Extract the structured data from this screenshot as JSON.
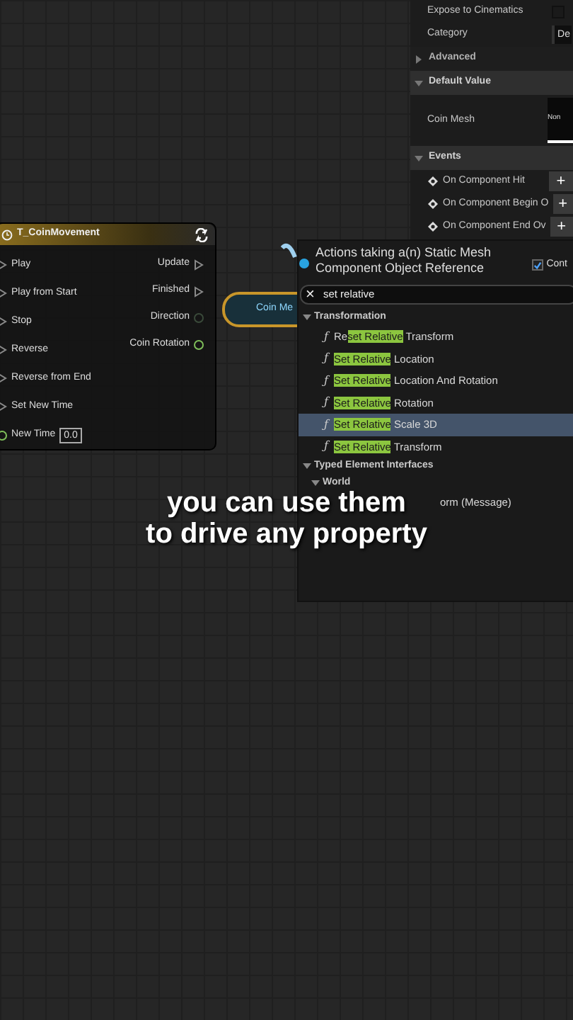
{
  "details": {
    "rows": [
      {
        "kind": "checkbox",
        "label": "Expose to Cinematics",
        "checked": false
      },
      {
        "kind": "field",
        "label": "Category",
        "value": "De"
      },
      {
        "kind": "section",
        "label": "Advanced",
        "expanded": false
      },
      {
        "kind": "section",
        "label": "Default Value",
        "expanded": true
      },
      {
        "kind": "mesh",
        "label": "Coin Mesh",
        "value": "Non"
      },
      {
        "kind": "section",
        "label": "Events",
        "expanded": true
      },
      {
        "kind": "event",
        "label": "On Component Hit",
        "button": "+"
      },
      {
        "kind": "event",
        "label": "On Component Begin O",
        "button": "+"
      },
      {
        "kind": "event",
        "label": "On Component End Ov",
        "button": "+"
      }
    ]
  },
  "timeline_node": {
    "title": "T_CoinMovement",
    "inputs": [
      {
        "label": "Play",
        "kind": "exec"
      },
      {
        "label": "Play from Start",
        "kind": "exec"
      },
      {
        "label": "Stop",
        "kind": "exec"
      },
      {
        "label": "Reverse",
        "kind": "exec"
      },
      {
        "label": "Reverse from End",
        "kind": "exec"
      },
      {
        "label": "Set New Time",
        "kind": "exec"
      },
      {
        "label": "New Time",
        "kind": "data",
        "color": "#7fbf5a",
        "value": "0.0"
      }
    ],
    "outputs": [
      {
        "label": "Update",
        "kind": "exec"
      },
      {
        "label": "Finished",
        "kind": "exec"
      },
      {
        "label": "Direction",
        "kind": "data",
        "color": "#3a4a3a"
      },
      {
        "label": "Coin Rotation",
        "kind": "data",
        "color": "#7fbf5a"
      }
    ]
  },
  "variable_node": {
    "label": "Coin Me"
  },
  "action_menu": {
    "title": "Actions taking a(n) Static Mesh Component Object Reference",
    "context_checkbox": {
      "label": "Cont",
      "checked": true
    },
    "search": {
      "clear": "×",
      "value": "set relative"
    },
    "groups": [
      {
        "label": "Transformation",
        "expanded": true,
        "items": [
          {
            "icon": "ƒ",
            "before": "Re",
            "match": "set Relative",
            "after": " Transform",
            "selected": false
          },
          {
            "icon": "ƒ",
            "match": "Set Relative",
            "after": " Location",
            "selected": false
          },
          {
            "icon": "ƒ",
            "match": "Set Relative",
            "after": " Location And Rotation",
            "selected": false
          },
          {
            "icon": "ƒ",
            "match": "Set Relative",
            "after": " Rotation",
            "selected": false
          },
          {
            "icon": "ƒ",
            "match": "Set Relative",
            "after": " Scale 3D",
            "selected": true
          },
          {
            "icon": "ƒ",
            "match": "Set Relative",
            "after": " Transform",
            "selected": false
          }
        ]
      },
      {
        "label": "Typed Element Interfaces",
        "expanded": true,
        "children": [
          {
            "label": "World",
            "expanded": true,
            "items": [
              {
                "after": "orm (Message)",
                "selected": false
              }
            ]
          }
        ]
      }
    ]
  },
  "caption": [
    "you can use them",
    "to drive any property"
  ]
}
